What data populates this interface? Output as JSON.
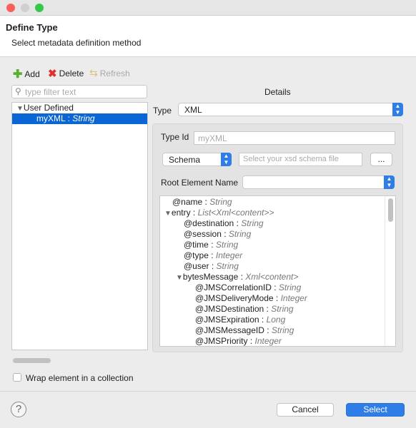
{
  "window": {
    "controls": [
      "close",
      "minimize",
      "maximize"
    ]
  },
  "header": {
    "title": "Define Type",
    "subtitle": "Select metadata definition method"
  },
  "toolbar": {
    "add": "Add",
    "delete": "Delete",
    "refresh": "Refresh"
  },
  "filter": {
    "placeholder": "type filter text"
  },
  "tree": {
    "group": "User Defined",
    "item_name": "myXML",
    "item_type": "String"
  },
  "details": {
    "title": "Details",
    "type_label": "Type",
    "type_value": "XML",
    "typeid_label": "Type Id",
    "typeid_placeholder": "myXML",
    "schema_value": "Schema",
    "schema_placeholder": "Select your xsd schema file",
    "browse": "...",
    "root_label": "Root Element Name",
    "root_value": ""
  },
  "schema_tree": [
    {
      "name": "@name",
      "type": "String",
      "level": 0,
      "expander": false
    },
    {
      "name": "entry",
      "type": "List<Xml<content>>",
      "level": 0,
      "expander": true
    },
    {
      "name": "@destination",
      "type": "String",
      "level": 1,
      "expander": false
    },
    {
      "name": "@session",
      "type": "String",
      "level": 1,
      "expander": false
    },
    {
      "name": "@time",
      "type": "String",
      "level": 1,
      "expander": false
    },
    {
      "name": "@type",
      "type": "Integer",
      "level": 1,
      "expander": false
    },
    {
      "name": "@user",
      "type": "String",
      "level": 1,
      "expander": false
    },
    {
      "name": "bytesMessage",
      "type": "Xml<content>",
      "level": 1,
      "expander": true
    },
    {
      "name": "@JMSCorrelationID",
      "type": "String",
      "level": 2,
      "expander": false
    },
    {
      "name": "@JMSDeliveryMode",
      "type": "Integer",
      "level": 2,
      "expander": false
    },
    {
      "name": "@JMSDestination",
      "type": "String",
      "level": 2,
      "expander": false
    },
    {
      "name": "@JMSExpiration",
      "type": "Long",
      "level": 2,
      "expander": false
    },
    {
      "name": "@JMSMessageID",
      "type": "String",
      "level": 2,
      "expander": false
    },
    {
      "name": "@JMSPriority",
      "type": "Integer",
      "level": 2,
      "expander": false
    }
  ],
  "wrap": {
    "label": "Wrap element in a collection",
    "checked": false
  },
  "footer": {
    "cancel": "Cancel",
    "select": "Select"
  },
  "colors": {
    "accent": "#2f7ee8",
    "selection": "#0a66d4"
  }
}
